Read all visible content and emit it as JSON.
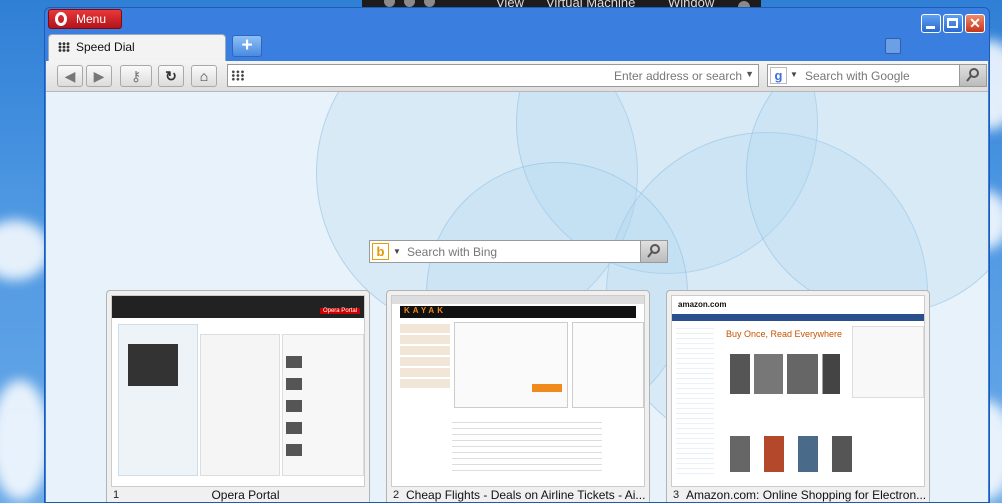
{
  "host_menu": {
    "items": [
      "View",
      "Virtual Machine",
      "Window"
    ]
  },
  "window": {
    "menu_label": "Menu"
  },
  "tabs": [
    {
      "label": "Speed Dial"
    }
  ],
  "toolbar": {
    "address_placeholder": "Enter address or search",
    "search_placeholder": "Search with Google"
  },
  "speed_dial": {
    "search_placeholder": "Search with Bing",
    "dials": [
      {
        "number": "1",
        "title": "Opera Portal",
        "thumb_header": "Opera Portal"
      },
      {
        "number": "2",
        "title": "Cheap Flights - Deals on Airline Tickets - Ai...",
        "thumb_header": "KAYAK"
      },
      {
        "number": "3",
        "title": "Amazon.com: Online Shopping for Electron...",
        "thumb_header": "amazon.com",
        "thumb_headline": "Buy Once, Read Everywhere"
      }
    ]
  },
  "colors": {
    "menu_red": "#c8181e",
    "window_blue": "#3a7fe0",
    "kayak_orange": "#f08a1c"
  }
}
